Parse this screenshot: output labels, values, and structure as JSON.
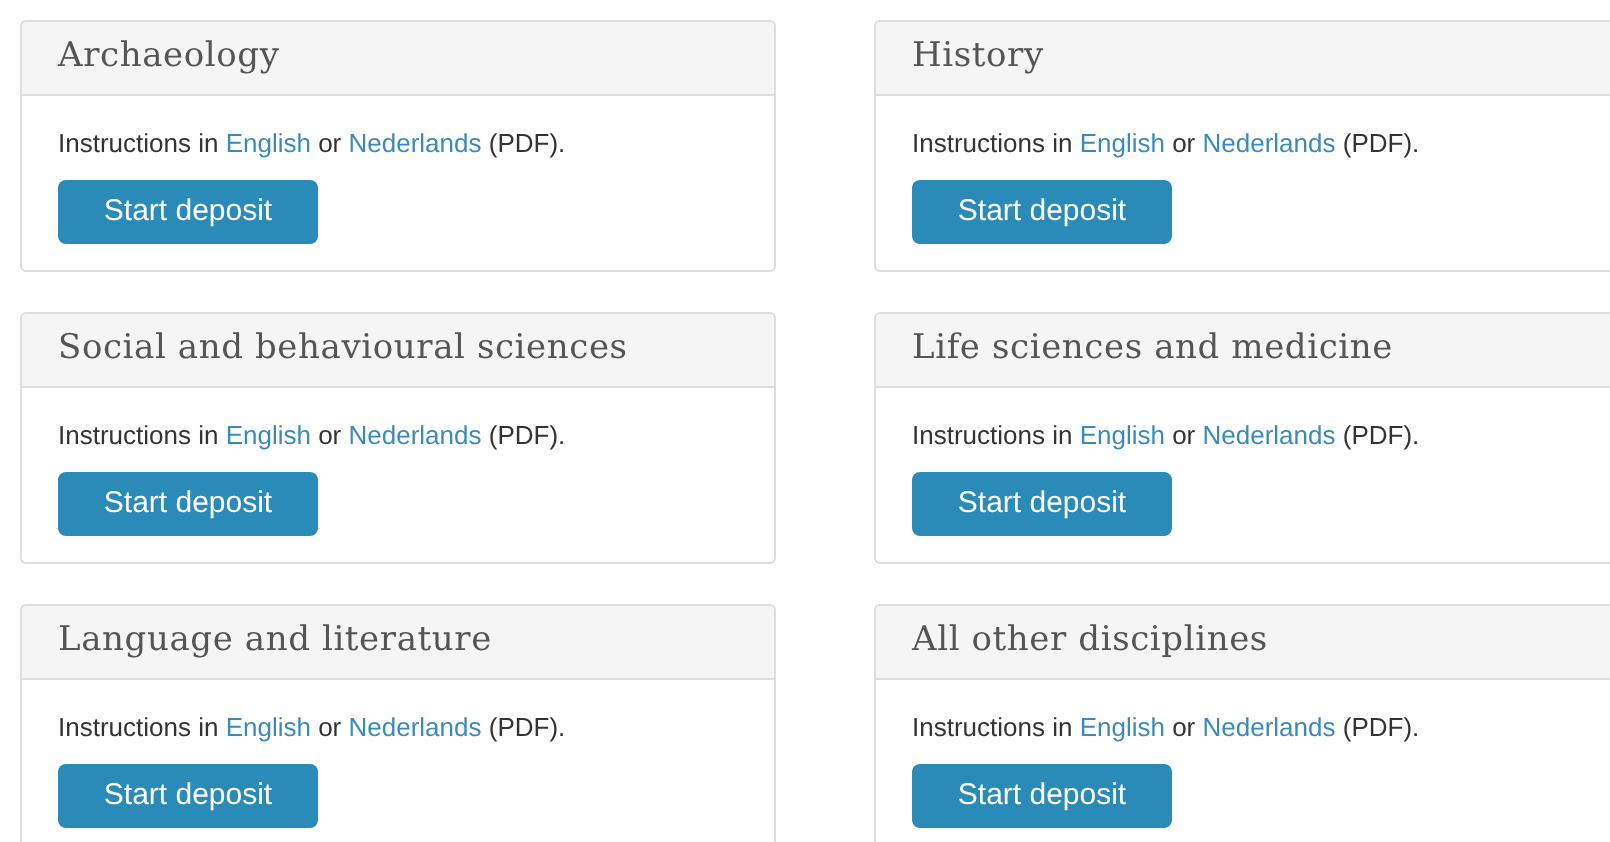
{
  "cards": [
    {
      "title": "Archaeology",
      "instructions": {
        "before": "Instructions in ",
        "link_1": "English",
        "middle": " or ",
        "link_2": "Nederlands",
        "after": " (PDF)."
      },
      "button": "Start deposit"
    },
    {
      "title": "History",
      "instructions": {
        "before": "Instructions in ",
        "link_1": "English",
        "middle": " or ",
        "link_2": "Nederlands",
        "after": " (PDF)."
      },
      "button": "Start deposit"
    },
    {
      "title": "Social and behavioural sciences",
      "instructions": {
        "before": "Instructions in ",
        "link_1": "English",
        "middle": " or ",
        "link_2": "Nederlands",
        "after": " (PDF)."
      },
      "button": "Start deposit"
    },
    {
      "title": "Life sciences and medicine",
      "instructions": {
        "before": "Instructions in ",
        "link_1": "English",
        "middle": " or ",
        "link_2": "Nederlands",
        "after": " (PDF)."
      },
      "button": "Start deposit"
    },
    {
      "title": "Language and literature",
      "instructions": {
        "before": "Instructions in ",
        "link_1": "English",
        "middle": " or ",
        "link_2": "Nederlands",
        "after": " (PDF)."
      },
      "button": "Start deposit"
    },
    {
      "title": "All other disciplines",
      "instructions": {
        "before": "Instructions in ",
        "link_1": "English",
        "middle": " or ",
        "link_2": "Nederlands",
        "after": " (PDF)."
      },
      "button": "Start deposit"
    }
  ]
}
